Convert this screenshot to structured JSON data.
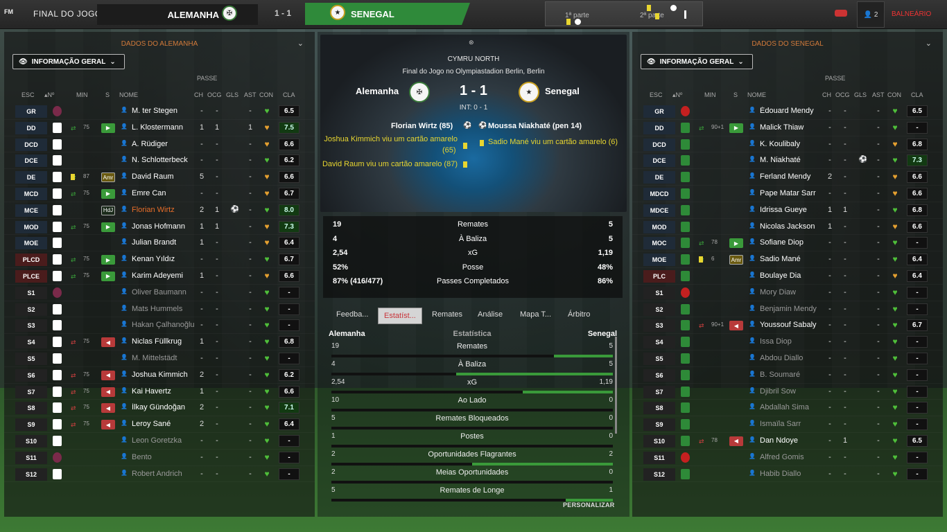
{
  "topbar": {
    "logo": "FM",
    "status": "FINAL DO JOGO",
    "home": "ALEMANHA",
    "score": "1 - 1",
    "away": "SENEGAL",
    "half1": "1ª parte",
    "half2": "2ª parte",
    "people_count": "2",
    "balneario": "BALNEÁRIO"
  },
  "left": {
    "title": "DADOS DO ALEMANHA",
    "info_select": "INFORMAÇÃO GERAL",
    "passe": "PASSE",
    "cols": {
      "esc": "ESC",
      "n": "Nº",
      "min": "MIN",
      "s": "S",
      "nome": "NOME",
      "ch": "CH",
      "ocg": "OCG",
      "gls": "GLS",
      "ast": "AST",
      "con": "CON",
      "cla": "CLA"
    },
    "rows": [
      {
        "pos": "GR",
        "kind": "gk",
        "min": "",
        "name": "M. ter Stegen",
        "ch": "-",
        "ocg": "-",
        "gls": "",
        "ast": "-",
        "cla": "6.5"
      },
      {
        "pos": "DD",
        "kind": "st",
        "min": "75",
        "name": "L. Klostermann",
        "ch": "1",
        "ocg": "1",
        "gls": "",
        "ast": "1",
        "cla": "7.5"
      },
      {
        "pos": "DCD",
        "kind": "st",
        "min": "",
        "name": "A. Rüdiger",
        "ch": "-",
        "ocg": "-",
        "gls": "",
        "ast": "-",
        "cla": "6.6"
      },
      {
        "pos": "DCE",
        "kind": "st",
        "min": "",
        "name": "N. Schlotterbeck",
        "ch": "-",
        "ocg": "-",
        "gls": "",
        "ast": "-",
        "cla": "6.2"
      },
      {
        "pos": "DE",
        "kind": "st",
        "min": "87",
        "name": "David Raum",
        "ch": "5",
        "ocg": "-",
        "gls": "",
        "ast": "-",
        "cla": "6.6",
        "badge": "Amr"
      },
      {
        "pos": "MCD",
        "kind": "st",
        "min": "75",
        "name": "Emre Can",
        "ch": "-",
        "ocg": "-",
        "gls": "",
        "ast": "-",
        "cla": "6.7"
      },
      {
        "pos": "MCE",
        "kind": "st",
        "min": "",
        "name": "Florian Wirtz",
        "ch": "2",
        "ocg": "1",
        "gls": "⚽",
        "ast": "-",
        "cla": "8.0",
        "badge": "HdJ"
      },
      {
        "pos": "MOD",
        "kind": "st",
        "min": "75",
        "name": "Jonas Hofmann",
        "ch": "1",
        "ocg": "1",
        "gls": "",
        "ast": "-",
        "cla": "7.3"
      },
      {
        "pos": "MOE",
        "kind": "st",
        "min": "",
        "name": "Julian Brandt",
        "ch": "1",
        "ocg": "-",
        "gls": "",
        "ast": "-",
        "cla": "6.4"
      },
      {
        "pos": "PLCD",
        "kind": "st",
        "min": "75",
        "name": "Kenan Yıldız",
        "ch": "-",
        "ocg": "-",
        "gls": "",
        "ast": "-",
        "cla": "6.7"
      },
      {
        "pos": "PLCE",
        "kind": "st",
        "min": "75",
        "name": "Karim Adeyemi",
        "ch": "1",
        "ocg": "-",
        "gls": "",
        "ast": "-",
        "cla": "6.6"
      },
      {
        "pos": "S1",
        "kind": "gksub",
        "min": "",
        "name": "Oliver Baumann",
        "ch": "-",
        "ocg": "-",
        "gls": "",
        "ast": "-",
        "cla": "-"
      },
      {
        "pos": "S2",
        "kind": "sub",
        "min": "",
        "name": "Mats Hummels",
        "ch": "-",
        "ocg": "-",
        "gls": "",
        "ast": "-",
        "cla": "-"
      },
      {
        "pos": "S3",
        "kind": "sub",
        "min": "",
        "name": "Hakan Çalhanoğlu",
        "ch": "-",
        "ocg": "-",
        "gls": "",
        "ast": "-",
        "cla": "-"
      },
      {
        "pos": "S4",
        "kind": "in",
        "min": "75",
        "name": "Niclas Füllkrug",
        "ch": "1",
        "ocg": "-",
        "gls": "",
        "ast": "-",
        "cla": "6.8"
      },
      {
        "pos": "S5",
        "kind": "sub",
        "min": "",
        "name": "M. Mittelstädt",
        "ch": "-",
        "ocg": "-",
        "gls": "",
        "ast": "-",
        "cla": "-"
      },
      {
        "pos": "S6",
        "kind": "in",
        "min": "75",
        "name": "Joshua Kimmich",
        "ch": "2",
        "ocg": "-",
        "gls": "",
        "ast": "-",
        "cla": "6.2"
      },
      {
        "pos": "S7",
        "kind": "in",
        "min": "75",
        "name": "Kai Havertz",
        "ch": "1",
        "ocg": "-",
        "gls": "",
        "ast": "-",
        "cla": "6.6"
      },
      {
        "pos": "S8",
        "kind": "in",
        "min": "75",
        "name": "İlkay Gündoğan",
        "ch": "2",
        "ocg": "-",
        "gls": "",
        "ast": "-",
        "cla": "7.1"
      },
      {
        "pos": "S9",
        "kind": "in",
        "min": "75",
        "name": "Leroy Sané",
        "ch": "2",
        "ocg": "-",
        "gls": "",
        "ast": "-",
        "cla": "6.4"
      },
      {
        "pos": "S10",
        "kind": "sub",
        "min": "",
        "name": "Leon Goretzka",
        "ch": "-",
        "ocg": "-",
        "gls": "",
        "ast": "-",
        "cla": "-"
      },
      {
        "pos": "S11",
        "kind": "gksub",
        "min": "",
        "name": "Bento",
        "ch": "-",
        "ocg": "-",
        "gls": "",
        "ast": "-",
        "cla": "-"
      },
      {
        "pos": "S12",
        "kind": "sub",
        "min": "",
        "name": "Robert Andrich",
        "ch": "-",
        "ocg": "-",
        "gls": "",
        "ast": "-",
        "cla": "-"
      }
    ]
  },
  "right": {
    "title": "DADOS DO SENEGAL",
    "info_select": "INFORMAÇÃO GERAL",
    "passe": "PASSE",
    "cols": {
      "esc": "ESC",
      "n": "Nº",
      "min": "MIN",
      "s": "S",
      "nome": "NOME",
      "ch": "CH",
      "ocg": "OCG",
      "gls": "GLS",
      "ast": "AST",
      "con": "CON",
      "cla": "CLA"
    },
    "rows": [
      {
        "pos": "GR",
        "kind": "gk",
        "min": "",
        "name": "Édouard Mendy",
        "ch": "-",
        "ocg": "-",
        "gls": "",
        "ast": "-",
        "cla": "6.5"
      },
      {
        "pos": "DD",
        "kind": "st",
        "min": "90+1",
        "name": "Malick Thiaw",
        "ch": "-",
        "ocg": "-",
        "gls": "",
        "ast": "-",
        "cla": "-"
      },
      {
        "pos": "DCD",
        "kind": "st",
        "min": "",
        "name": "K. Koulibaly",
        "ch": "-",
        "ocg": "-",
        "gls": "",
        "ast": "-",
        "cla": "6.8"
      },
      {
        "pos": "DCE",
        "kind": "st",
        "min": "",
        "name": "M. Niakhaté",
        "ch": "-",
        "ocg": "-",
        "gls": "⚽",
        "ast": "-",
        "cla": "7.3"
      },
      {
        "pos": "DE",
        "kind": "st",
        "min": "",
        "name": "Ferland Mendy",
        "ch": "2",
        "ocg": "-",
        "gls": "",
        "ast": "-",
        "cla": "6.6"
      },
      {
        "pos": "MDCD",
        "kind": "st",
        "min": "",
        "name": "Pape Matar Sarr",
        "ch": "-",
        "ocg": "-",
        "gls": "",
        "ast": "-",
        "cla": "6.6"
      },
      {
        "pos": "MDCE",
        "kind": "st",
        "min": "",
        "name": "Idrissa Gueye",
        "ch": "1",
        "ocg": "1",
        "gls": "",
        "ast": "-",
        "cla": "6.8"
      },
      {
        "pos": "MOD",
        "kind": "st",
        "min": "",
        "name": "Nicolas Jackson",
        "ch": "1",
        "ocg": "-",
        "gls": "",
        "ast": "-",
        "cla": "6.6"
      },
      {
        "pos": "MOC",
        "kind": "st",
        "min": "78",
        "name": "Sofiane Diop",
        "ch": "-",
        "ocg": "-",
        "gls": "",
        "ast": "-",
        "cla": "-"
      },
      {
        "pos": "MOE",
        "kind": "st",
        "min": "6",
        "name": "Sadio Mané",
        "ch": "-",
        "ocg": "-",
        "gls": "",
        "ast": "-",
        "cla": "6.4",
        "badge": "Amr"
      },
      {
        "pos": "PLC",
        "kind": "st",
        "min": "",
        "name": "Boulaye Dia",
        "ch": "-",
        "ocg": "-",
        "gls": "",
        "ast": "-",
        "cla": "6.4"
      },
      {
        "pos": "S1",
        "kind": "gksub",
        "min": "",
        "name": "Mory Diaw",
        "ch": "-",
        "ocg": "-",
        "gls": "",
        "ast": "-",
        "cla": "-"
      },
      {
        "pos": "S2",
        "kind": "sub",
        "min": "",
        "name": "Benjamin Mendy",
        "ch": "-",
        "ocg": "-",
        "gls": "",
        "ast": "-",
        "cla": "-"
      },
      {
        "pos": "S3",
        "kind": "in",
        "min": "90+1",
        "name": "Youssouf Sabaly",
        "ch": "-",
        "ocg": "-",
        "gls": "",
        "ast": "-",
        "cla": "6.7"
      },
      {
        "pos": "S4",
        "kind": "sub",
        "min": "",
        "name": "Issa Diop",
        "ch": "-",
        "ocg": "-",
        "gls": "",
        "ast": "-",
        "cla": "-"
      },
      {
        "pos": "S5",
        "kind": "sub",
        "min": "",
        "name": "Abdou Diallo",
        "ch": "-",
        "ocg": "-",
        "gls": "",
        "ast": "-",
        "cla": "-"
      },
      {
        "pos": "S6",
        "kind": "sub",
        "min": "",
        "name": "B. Soumaré",
        "ch": "-",
        "ocg": "-",
        "gls": "",
        "ast": "-",
        "cla": "-"
      },
      {
        "pos": "S7",
        "kind": "sub",
        "min": "",
        "name": "Djibril Sow",
        "ch": "-",
        "ocg": "-",
        "gls": "",
        "ast": "-",
        "cla": "-"
      },
      {
        "pos": "S8",
        "kind": "sub",
        "min": "",
        "name": "Abdallah Sima",
        "ch": "-",
        "ocg": "-",
        "gls": "",
        "ast": "-",
        "cla": "-"
      },
      {
        "pos": "S9",
        "kind": "sub",
        "min": "",
        "name": "Ismaïla Sarr",
        "ch": "-",
        "ocg": "-",
        "gls": "",
        "ast": "-",
        "cla": "-"
      },
      {
        "pos": "S10",
        "kind": "in",
        "min": "78",
        "name": "Dan Ndoye",
        "ch": "-",
        "ocg": "1",
        "gls": "",
        "ast": "-",
        "cla": "6.5"
      },
      {
        "pos": "S11",
        "kind": "gksub",
        "min": "",
        "name": "Alfred Gomis",
        "ch": "-",
        "ocg": "-",
        "gls": "",
        "ast": "-",
        "cla": "-"
      },
      {
        "pos": "S12",
        "kind": "sub",
        "min": "",
        "name": "Habib Diallo",
        "ch": "-",
        "ocg": "-",
        "gls": "",
        "ast": "-",
        "cla": "-"
      }
    ]
  },
  "match": {
    "competition": "CYMRU NORTH",
    "venue": "Final do Jogo no Olympiastadion Berlin, Berlin",
    "home": "Alemanha",
    "away": "Senegal",
    "score": "1 - 1",
    "interval": "INT: 0 - 1",
    "home_scorer": "Florian Wirtz (85)",
    "away_scorer": "Moussa Niakhaté (pen 14)",
    "card1": "Joshua Kimmich viu um cartão amarelo",
    "card1_min": "(65)",
    "card2": "Sadio Mané viu um cartão amarelo (6)",
    "card3": "David Raum viu um cartão amarelo (87)"
  },
  "summary": [
    {
      "l": "19",
      "m": "Remates",
      "r": "5"
    },
    {
      "l": "4",
      "m": "À Baliza",
      "r": "5"
    },
    {
      "l": "2,54",
      "m": "xG",
      "r": "1,19"
    },
    {
      "l": "52%",
      "m": "Posse",
      "r": "48%"
    },
    {
      "l": "87% (416/477)",
      "m": "Passes Completados",
      "r": "86%"
    }
  ],
  "tabs": [
    "Feedba...",
    "Estatíst...",
    "Remates",
    "Análise",
    "Mapa T...",
    "Árbitro"
  ],
  "stats_head": {
    "home": "Alemanha",
    "mid": "Estatística",
    "away": "Senegal"
  },
  "stats": [
    {
      "l": "19",
      "m": "Remates",
      "r": "5",
      "hv": 19,
      "av": 5
    },
    {
      "l": "4",
      "m": "À Baliza",
      "r": "5",
      "hv": 4,
      "av": 5
    },
    {
      "l": "2,54",
      "m": "xG",
      "r": "1,19",
      "hv": 2.54,
      "av": 1.19
    },
    {
      "l": "10",
      "m": "Ao Lado",
      "r": "0",
      "hv": 10,
      "av": 0
    },
    {
      "l": "5",
      "m": "Remates Bloqueados",
      "r": "0",
      "hv": 5,
      "av": 0
    },
    {
      "l": "1",
      "m": "Postes",
      "r": "0",
      "hv": 1,
      "av": 0
    },
    {
      "l": "2",
      "m": "Oportunidades Flagrantes",
      "r": "2",
      "hv": 2,
      "av": 2
    },
    {
      "l": "2",
      "m": "Meias Oportunidades",
      "r": "0",
      "hv": 2,
      "av": 0
    },
    {
      "l": "5",
      "m": "Remates de Longe",
      "r": "1",
      "hv": 5,
      "av": 1
    }
  ],
  "personalizar": "PERSONALIZAR",
  "colors": {
    "home_shirt": "#ffffff",
    "away_shirt": "#2e8a38",
    "gk_home": "#7a2a4a",
    "gk_away": "#c42020",
    "accent": "#2f8a3a",
    "card": "#e8d630"
  }
}
